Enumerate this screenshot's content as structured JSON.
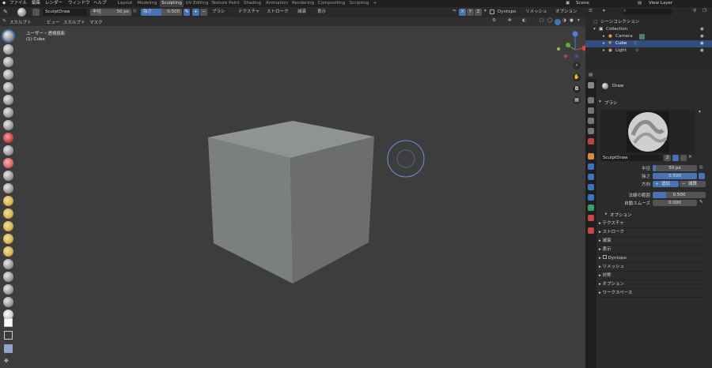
{
  "menu": {
    "items": [
      "ファイル",
      "編集",
      "レンダー",
      "ウィンドウ",
      "ヘルプ"
    ],
    "workspaces": [
      "Layout",
      "Modeling",
      "Sculpting",
      "UV Editing",
      "Texture Paint",
      "Shading",
      "Animation",
      "Rendering",
      "Compositing",
      "Scripting"
    ],
    "active_workspace": "Sculpting",
    "add_tab": "+",
    "scene_name": "Scene",
    "view_layer": "View Layer"
  },
  "tool_header": {
    "brush_name": "SculptDraw",
    "radius_label": "半径",
    "radius_value": "50 px",
    "strength_label": "強さ",
    "strength_value": "0.500",
    "plus": "+",
    "minus": "−",
    "brush_menu": "ブラシ",
    "texture_menu": "テクスチャ",
    "stroke_menu": "ストローク",
    "falloff_menu": "減衰",
    "display_menu": "表示",
    "axes": [
      "X",
      "Y",
      "Z"
    ],
    "dyntopo": "Dyntopo",
    "remesh": "リメッシュ",
    "options": "オプション"
  },
  "view_header": {
    "mode": "スカルプト",
    "view": "ビュー",
    "sculpt": "スカルプト",
    "mask": "マスク"
  },
  "viewport": {
    "view_name": "ユーザー・透視投影",
    "object_name": "(1) Cube"
  },
  "outliner": {
    "search_placeholder": "",
    "rows": [
      {
        "label": "シーンコレクション",
        "depth": 0
      },
      {
        "label": "Collection",
        "depth": 1
      },
      {
        "label": "Camera",
        "depth": 2
      },
      {
        "label": "Cube",
        "depth": 2,
        "selected": true
      },
      {
        "label": "Light",
        "depth": 2
      }
    ]
  },
  "properties": {
    "brush_tool": "Draw",
    "brush_section": "ブラシ",
    "brush_name": "SculptDraw",
    "users": "2",
    "radius_label": "半径",
    "radius_value": "50 px",
    "strength_label": "強さ",
    "strength_value": "0.500",
    "direction_label": "方向",
    "direction_add": "追加",
    "direction_sub": "減算",
    "normal_radius_label": "法線の範囲",
    "normal_radius_value": "0.500",
    "autosmooth_label": "自動スムーズ",
    "autosmooth_value": "0.000",
    "options_sub": "オプション",
    "panels": [
      "テクスチャ",
      "ストローク",
      "減衰",
      "表示",
      "Dyntopo",
      "リメッシュ",
      "対称",
      "オプション",
      "ワークスペース"
    ]
  },
  "colors": {
    "accent": "#4772b3",
    "viewport_bg": "#3d3d3d",
    "selection": "#334d80"
  }
}
